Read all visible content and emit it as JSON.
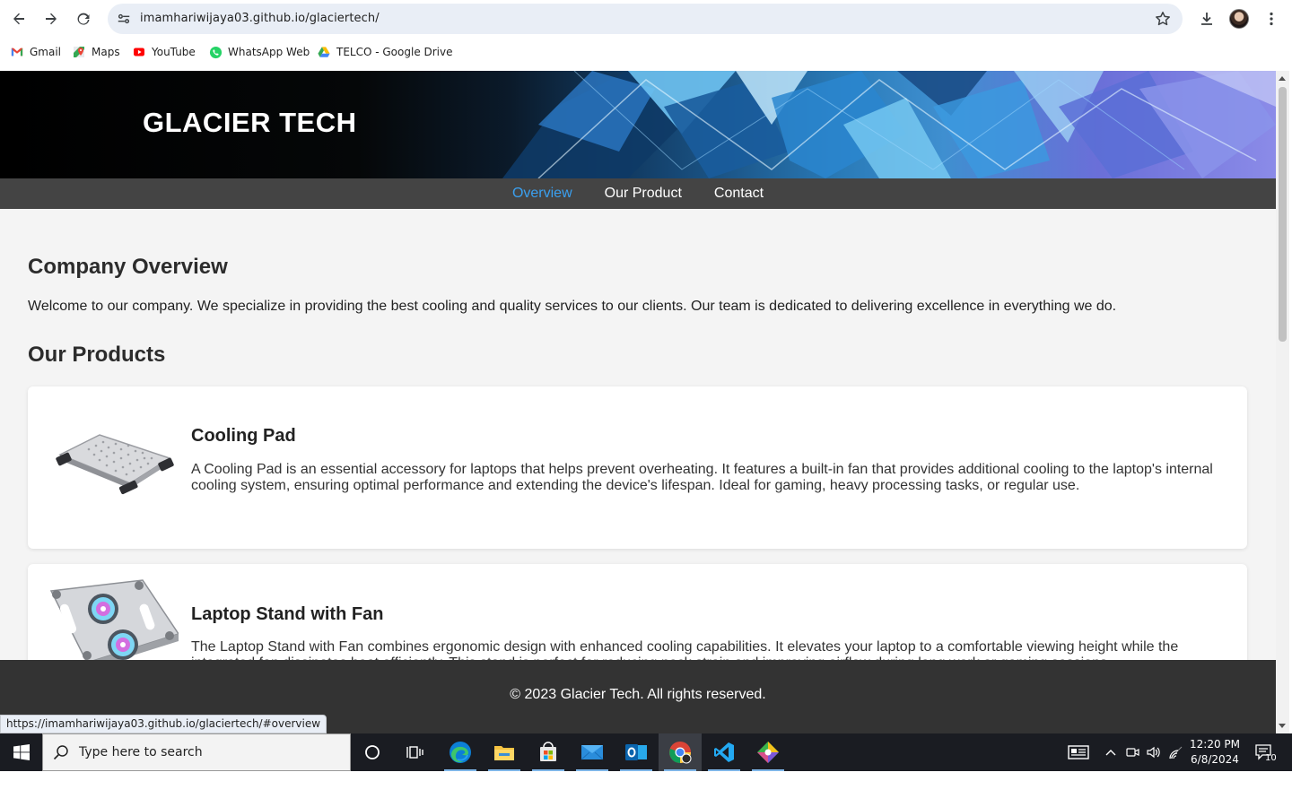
{
  "browser": {
    "url": "imamhariwijaya03.github.io/glaciertech/",
    "status_url": "https://imamhariwijaya03.github.io/glaciertech/#overview",
    "bookmarks": [
      {
        "label": "Gmail",
        "icon": "gmail-icon"
      },
      {
        "label": "Maps",
        "icon": "maps-icon"
      },
      {
        "label": "YouTube",
        "icon": "youtube-icon"
      },
      {
        "label": "WhatsApp Web",
        "icon": "whatsapp-icon"
      },
      {
        "label": "TELCO - Google Drive",
        "icon": "google-drive-icon"
      }
    ]
  },
  "site": {
    "brand": "GLACIER TECH",
    "nav": [
      {
        "label": "Overview",
        "active": true
      },
      {
        "label": "Our Product",
        "active": false
      },
      {
        "label": "Contact",
        "active": false
      }
    ],
    "overview": {
      "heading": "Company Overview",
      "text": "Welcome to our company. We specialize in providing the best cooling and quality services to our clients. Our team is dedicated to delivering excellence in everything we do."
    },
    "products": {
      "heading": "Our Products",
      "items": [
        {
          "title": "Cooling Pad",
          "description": "A Cooling Pad is an essential accessory for laptops that helps prevent overheating. It features a built-in fan that provides additional cooling to the laptop's internal cooling system, ensuring optimal performance and extending the device's lifespan. Ideal for gaming, heavy processing tasks, or regular use."
        },
        {
          "title": "Laptop Stand with Fan",
          "description": "The Laptop Stand with Fan combines ergonomic design with enhanced cooling capabilities. It elevates your laptop to a comfortable viewing height while the integrated fan dissipates heat efficiently. This stand is perfect for reducing neck strain and improving airflow during long work or gaming sessions."
        }
      ]
    },
    "footer": "© 2023 Glacier Tech. All rights reserved."
  },
  "taskbar": {
    "search_placeholder": "Type here to search",
    "time": "12:20 PM",
    "date": "6/8/2024",
    "notification_count": "10"
  },
  "colors": {
    "nav_active": "#3aa0f0",
    "navbar_bg": "#444444",
    "footer_bg": "#333333",
    "page_bg": "#f4f4f4"
  }
}
